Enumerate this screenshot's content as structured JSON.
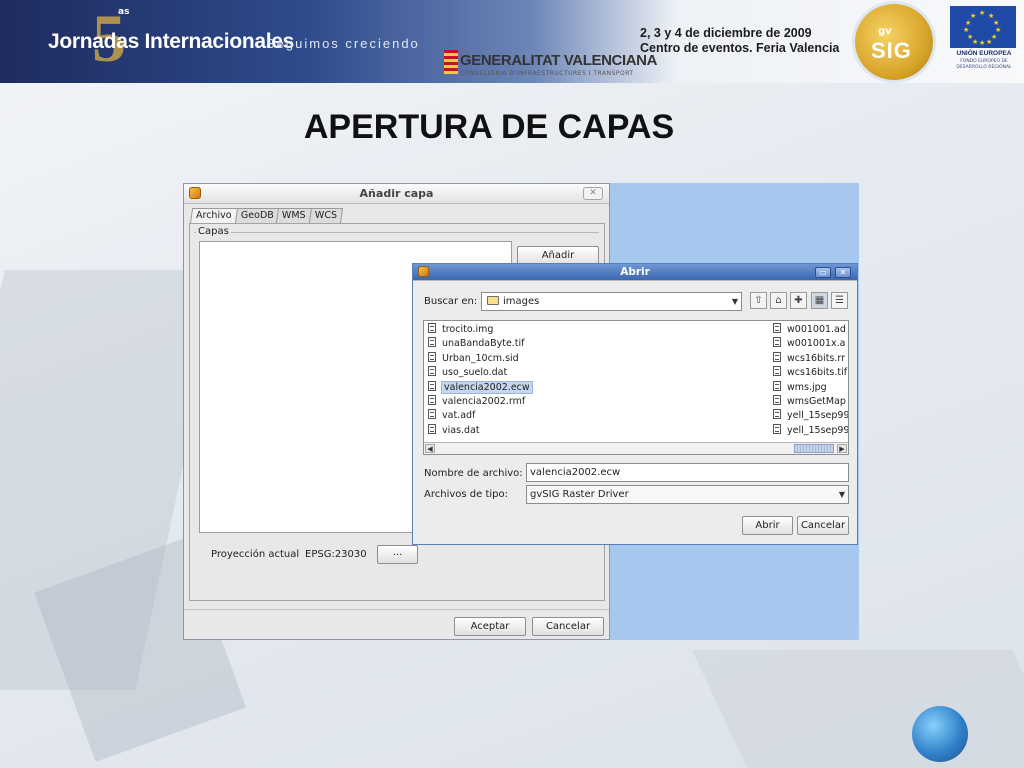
{
  "header": {
    "event_number": "5",
    "event_sup": "as",
    "event_title": "Jornadas Internacionales",
    "tagline": "Seguimos creciendo",
    "sponsor_name": "GENERALITAT VALENCIANA",
    "sponsor_sub": "CONSELLERIA D'INFRAESTRUCTURES I TRANSPORT",
    "date": "2, 3 y 4 de diciembre de 2009",
    "venue": "Centro de eventos. Feria Valencia",
    "gvsig_top": "gv",
    "gvsig_text": "SIG",
    "eu_label": "UNIÓN EUROPEA",
    "eu_sub": "FONDO EUROPEO DE DESARROLLO REGIONAL",
    "colors": {
      "banner_dark": "#1e2b5e",
      "gvsig_gold": "#d9a62b",
      "eu_blue": "#1f4aa8"
    }
  },
  "slide_title": "APERTURA DE CAPAS",
  "add_layer_dialog": {
    "title": "Añadir capa",
    "tabs": [
      "Archivo",
      "GeoDB",
      "WMS",
      "WCS"
    ],
    "active_tab": "Archivo",
    "group_label": "Capas",
    "add_button": "Añadir",
    "projection_label": "Proyección actual",
    "projection_value": "EPSG:23030",
    "projection_button": "...",
    "ok_button": "Aceptar",
    "cancel_button": "Cancelar"
  },
  "open_dialog": {
    "title": "Abrir",
    "look_in_label": "Buscar en:",
    "look_in_value": "images",
    "files_col1": [
      {
        "name": "trocito.img"
      },
      {
        "name": "unaBandaByte.tif"
      },
      {
        "name": "Urban_10cm.sid"
      },
      {
        "name": "uso_suelo.dat"
      },
      {
        "name": "valencia2002.ecw",
        "selected": true
      },
      {
        "name": "valencia2002.rmf"
      },
      {
        "name": "vat.adf"
      },
      {
        "name": "vias.dat"
      }
    ],
    "files_col2": [
      {
        "name": "w001001.ad"
      },
      {
        "name": "w001001x.a"
      },
      {
        "name": "wcs16bits.rr"
      },
      {
        "name": "wcs16bits.tif"
      },
      {
        "name": "wms.jpg"
      },
      {
        "name": "wmsGetMap"
      },
      {
        "name": "yell_15sep99"
      },
      {
        "name": "yell_15sep99"
      }
    ],
    "file_name_label": "Nombre de archivo:",
    "file_name_value": "valencia2002.ecw",
    "file_type_label": "Archivos de tipo:",
    "file_type_value": "gvSIG Raster Driver",
    "open_button": "Abrir",
    "cancel_button": "Cancelar"
  }
}
